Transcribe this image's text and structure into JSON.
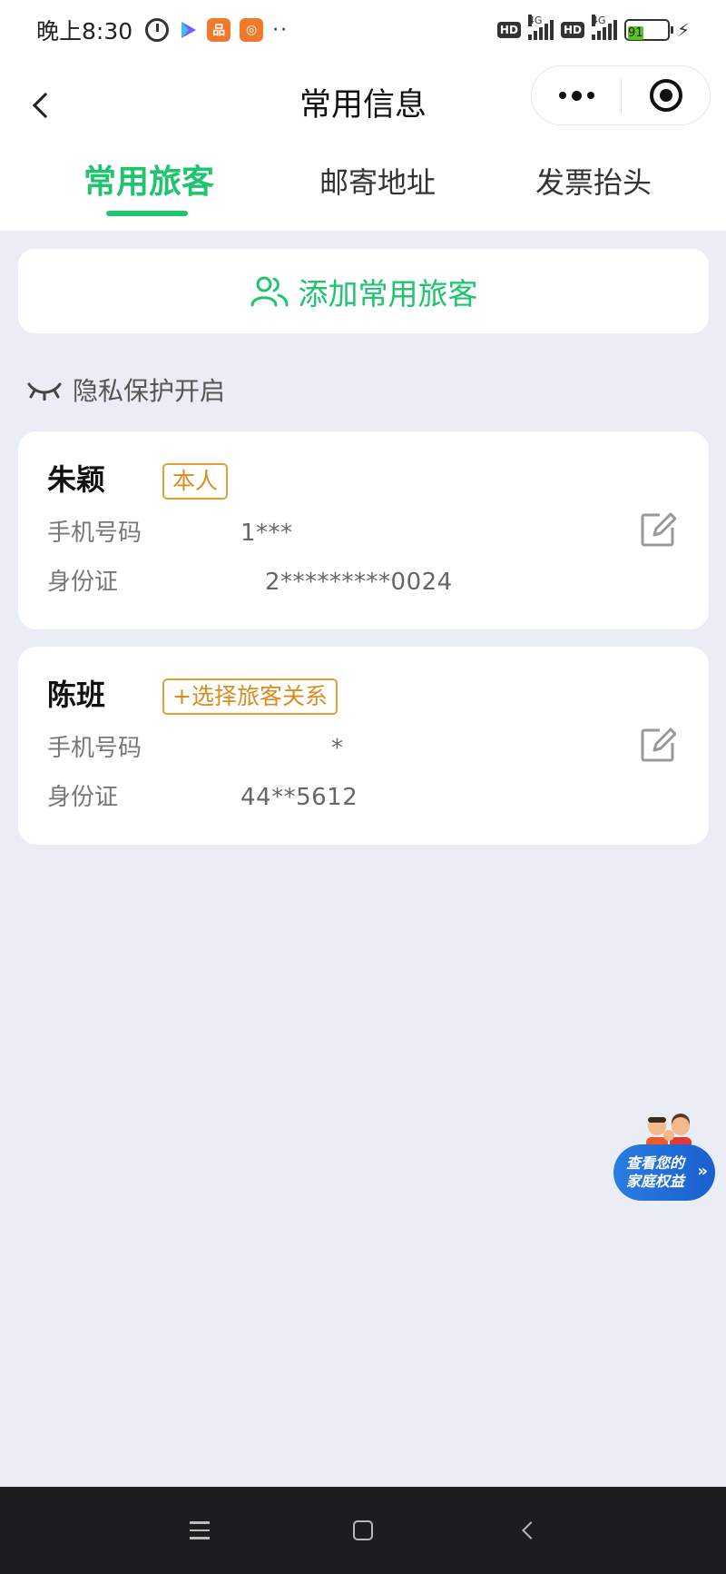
{
  "status_bar": {
    "time": "晚上8:30",
    "app_badge_2": "品",
    "app_badge_3": "◎",
    "more_dots": "··",
    "hd_label": "HD",
    "network": "4G",
    "battery": "91",
    "battery_fill_percent": 91
  },
  "nav": {
    "title": "常用信息"
  },
  "tabs": [
    {
      "label": "常用旅客",
      "active": true
    },
    {
      "label": "邮寄地址",
      "active": false
    },
    {
      "label": "发票抬头",
      "active": false
    }
  ],
  "add_passenger": {
    "label": "添加常用旅客"
  },
  "privacy": {
    "label": "隐私保护开启"
  },
  "passengers": [
    {
      "name": "朱颖",
      "badge": "本人",
      "phone_label": "手机号码",
      "phone_value": "1***",
      "id_label": "身份证",
      "id_value": "2*********0024"
    },
    {
      "name": "陈班",
      "badge": "+选择旅客关系",
      "phone_label": "手机号码",
      "phone_value": "*",
      "id_label": "身份证",
      "id_value": "44**5612"
    }
  ],
  "float_banner": {
    "line1": "查看您的",
    "line2": "家庭权益",
    "arrow": "»"
  },
  "colors": {
    "accent": "#1ec46e",
    "badge": "#e3a039",
    "background": "#eaedf5",
    "banner": "#2a7de1"
  }
}
